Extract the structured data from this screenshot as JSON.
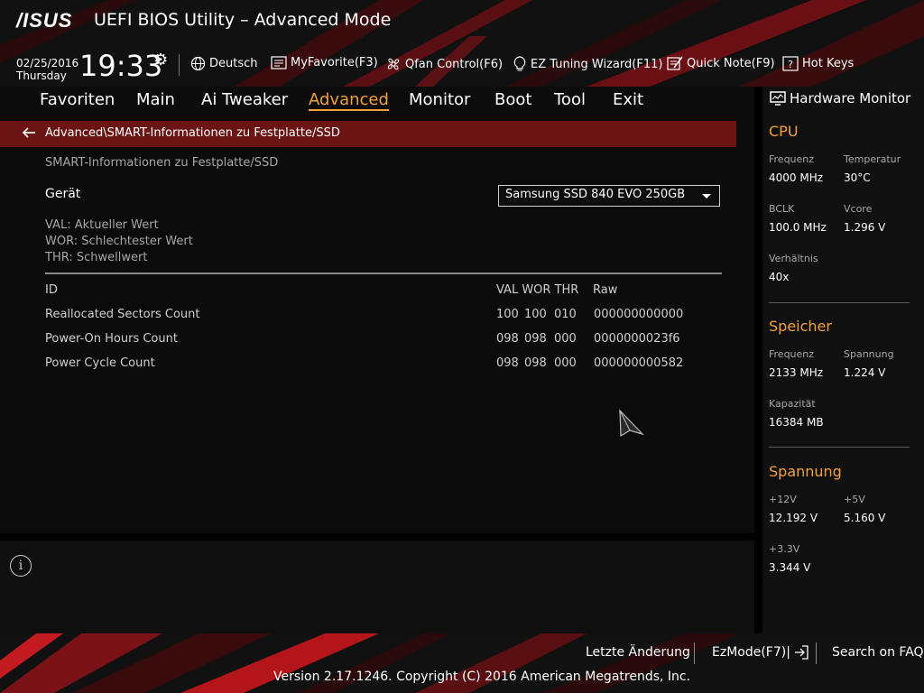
{
  "header": {
    "brand": "/ISUS",
    "title": "UEFI BIOS Utility – Advanced Mode",
    "date": "02/25/2016",
    "weekday": "Thursday",
    "time": "19:33",
    "tools": [
      {
        "label": "Deutsch",
        "icon": "globe-icon"
      },
      {
        "label": "MyFavorite(F3)",
        "icon": "favorite-icon"
      },
      {
        "label": "Qfan Control(F6)",
        "icon": "fan-icon"
      },
      {
        "label": "EZ Tuning Wizard(F11)",
        "icon": "lightbulb-icon"
      },
      {
        "label": "Quick Note(F9)",
        "icon": "note-icon"
      },
      {
        "label": "Hot Keys",
        "icon": "question-icon"
      }
    ]
  },
  "menu": {
    "items": [
      "Favoriten",
      "Main",
      "Ai Tweaker",
      "Advanced",
      "Monitor",
      "Boot",
      "Tool",
      "Exit"
    ],
    "active": "Advanced"
  },
  "breadcrumb": "Advanced\\SMART-Informationen zu Festplatte/SSD",
  "content": {
    "subtitle": "SMART-Informationen zu Festplatte/SSD",
    "device_label": "Gerät",
    "device_value": "Samsung SSD 840 EVO 250GB",
    "legend": [
      "VAL: Aktueller Wert",
      "WOR: Schlechtester Wert",
      "THR: Schwellwert"
    ],
    "table": {
      "col_id": "ID",
      "col_vwt": "VAL WOR THR",
      "col_raw": "Raw",
      "rows": [
        {
          "id": "Reallocated Sectors Count",
          "val": "100",
          "wor": "100",
          "thr": "010",
          "raw": "000000000000"
        },
        {
          "id": "Power-On Hours Count",
          "val": "098",
          "wor": "098",
          "thr": "000",
          "raw": "0000000023f6"
        },
        {
          "id": "Power Cycle Count",
          "val": "098",
          "wor": "098",
          "thr": "000",
          "raw": "000000000582"
        }
      ]
    }
  },
  "hardware_monitor": {
    "title": "Hardware Monitor",
    "cpu": {
      "heading": "CPU",
      "freq_label": "Frequenz",
      "freq_value": "4000 MHz",
      "temp_label": "Temperatur",
      "temp_value": "30°C",
      "bclk_label": "BCLK",
      "bclk_value": "100.0 MHz",
      "vcore_label": "Vcore",
      "vcore_value": "1.296 V",
      "ratio_label": "Verhältnis",
      "ratio_value": "40x"
    },
    "memory": {
      "heading": "Speicher",
      "freq_label": "Frequenz",
      "freq_value": "2133 MHz",
      "volt_label": "Spannung",
      "volt_value": "1.224 V",
      "cap_label": "Kapazität",
      "cap_value": "16384 MB"
    },
    "voltage": {
      "heading": "Spannung",
      "v12_label": "+12V",
      "v12_value": "12.192 V",
      "v5_label": "+5V",
      "v5_value": "5.160 V",
      "v33_label": "+3.3V",
      "v33_value": "3.344 V"
    }
  },
  "footer": {
    "last_change": "Letzte Änderung",
    "ezmode": "EzMode(F7)|",
    "faq": "Search on FAQ",
    "copyright": "Version 2.17.1246. Copyright (C) 2016 American Megatrends, Inc."
  },
  "colors": {
    "accent": "#f1a13b",
    "breadcrumb_bg": "#6b1414",
    "stripe_red": "#b3151b"
  }
}
